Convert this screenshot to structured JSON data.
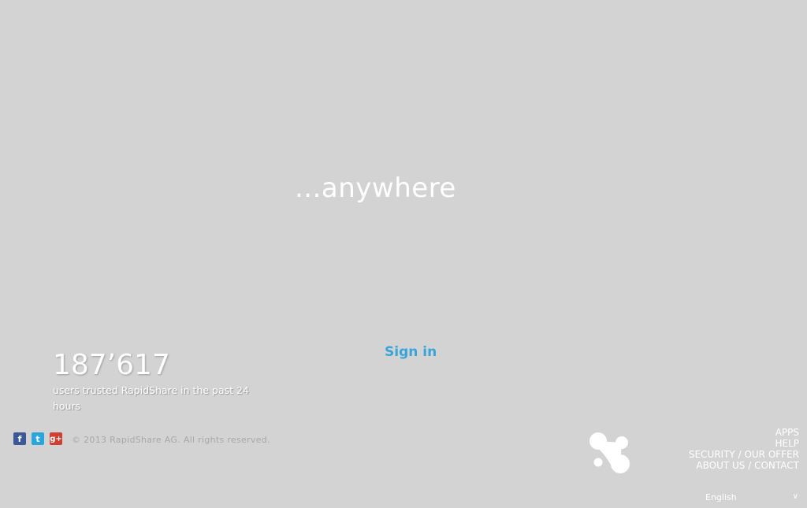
{
  "hero": {
    "tagline": "...anywhere"
  },
  "auth": {
    "signin_label": "Sign in"
  },
  "stats": {
    "count": "187’617",
    "caption": "users trusted RapidShare in the past 24 hours"
  },
  "social": {
    "facebook_glyph": "f",
    "twitter_glyph": "t",
    "googleplus_glyph": "g+"
  },
  "footer": {
    "copyright": "© 2013 RapidShare AG. All rights reserved.",
    "links": {
      "apps": "APPS",
      "help": "HELP",
      "security": "SECURITY",
      "our_offer": "OUR OFFER",
      "about_us": "ABOUT US",
      "contact": "CONTACT",
      "separator": " / "
    }
  },
  "language": {
    "selected": "English",
    "arrow": "∨"
  },
  "colors": {
    "background": "#d3d3d3",
    "accent": "#3aa4d8",
    "facebook": "#3b5998",
    "twitter": "#2aa6dc",
    "googleplus": "#d13f32"
  }
}
